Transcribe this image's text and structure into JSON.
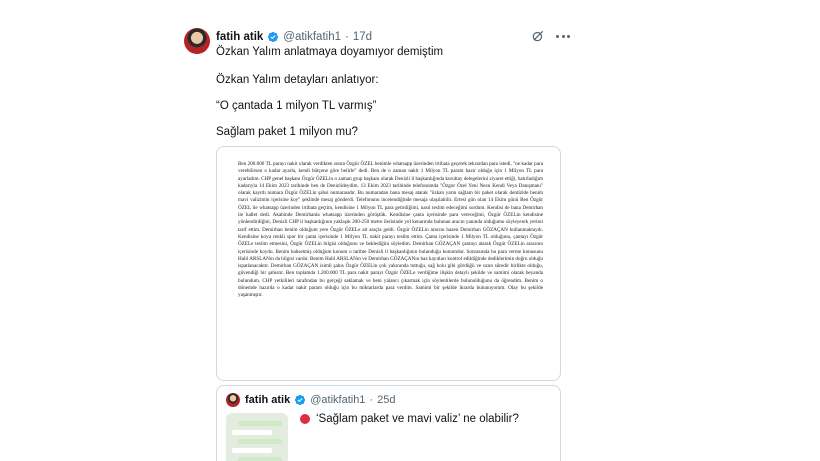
{
  "tweet": {
    "author_name": "fatih atik",
    "handle": "@atikfatih1",
    "separator": "·",
    "age": "17d",
    "lines": [
      "Özkan Yalım anlatmaya doyamıyor demiştim",
      "Özkan Yalım detayları anlatıyor:",
      "“O çantada 1 milyon TL varmış”",
      "Sağlam paket 1 milyon mu?"
    ],
    "document_text": "Ben 200.000 TL parayı nakit olarak verdikten sonra Özgür ÖZEL benimle whatsapp üzerinden irtibata geçerek tekrardan para istedi, \"ne kadar para verebilirsen o kadar ayarla, kendi bütçene göre belirle\" dedi. Ben de o zaman nakit 1 Milyon TL param hazır olduğu için 1 Milyon TL para ayarladım. CHP genel başkanı Özgür ÖZELin o zaman grup başkanı olarak Denizli il başkanlığında kurultay delegelerini ziyaret ettiği, hatırladığım kadarıyla 14 Ekim 2023 tarihinde ben de Denizlideydim. 13 Ekim 2023 tarihinde telefonumda \"Özgur Özel Yeni Nesıı Kendi Veya Danışmanı\" olarak kayıtlı numara Özgür ÖZELin şahsi numarasıdır. Bu numaradan bana mesaj atarak \"özkan yarın sağlam bir paket olarak dentizlde benim mavi valizimin içerisine koy\" şeklinde mesaj gönderdi. Telefonunu incelendiğinde mesaja ulaşılabilir. Ertesi gün olan 14 Ekim günü Ben Özgür ÖZEL ile whatsapp üzerinden irtibata geçtim, kendisine 1 Milyon TL para getirdiğimi, nasıl teslim edeceğimi sordum. Kendisi de bana Demirhan ile hallet dedi. Akabinde Demirhanla whatsapp üzerinden görüştük. Kendisine çanta içerisinde para vereceğimi, Özgür ÖZELin kendisine yönlendirdiğini, Denizli CHP il başkanlığının yaklaşık 200-250 metre ilerisinde yol kenarında bulunan aracın yanında olduğumu söyleyerek yerimi tarif ettim. Demirhan benim olduğum yere Özgür ÖZELe ait araçla geldi. Özgür ÖZELin aracını bazen Demirhan GÖZAÇAN kullanmaktaydı. Kendisine koyu renkli spor bir çanta içerisinde 1 Milyon TL nakit parayı teslim ettim. Çanta içerisinde 1 Milyon TL olduğunu, çantayı Özgür ÖZELe teslim etmesini, Özgür ÖZELin bilgisi olduğunu ve beklediğini söyledim. Demirhan GÖZAÇAN çantayı alarak Özgür ÖZELin aracının içerisinde koydu. Benim bahsetmiş olduğum konum o tarihte Denizli il başkanlığının bulunduğu konumdur. Sonrasında bu para verme konusunu Halil ARSLANın da bilgisi vardır. Benim Halil ARSLANın ve Demirhan GÖZAÇANın baz kayıtları kontrol edildiğinde dediklerimin doğru olduğu ispatlanacaktır. Demirhan GÖZAÇAN isimli şahıs Özgür ÖZELin çok yakınında tuttuğu, sağ kolu gibi gördüğü ve uzun süredir birlikte olduğu, güvendiği bir şahıstır. Ben toplamda 1.200.000 TL para nakit parayı Özgür ÖZELe verdiğime ilişkin detaylı şekilde ve samimi olarak beyanda bulundum. CHP yetkilileri tarafından bu gerçeği saklamak ve beni yalancı çıkarmak için söylentilerde bulunulduğunu da öğrendim. Benim o dönemde hazırda o kadar nakit param olduğu için bu miktarlarda para verdim. Samimi bir şekilde ikrarda bulunuyorum. Olay bu şekilde yaşanmıştır."
  },
  "quoted_tweet": {
    "author_name": "fatih atik",
    "handle": "@atikfatih1",
    "separator": "·",
    "age": "25d",
    "text": "‘Sağlam paket ve mavi valiz’ ne olabilir?"
  },
  "colors": {
    "verified_blue": "#1d9bf0",
    "secondary_text": "#536471",
    "red_circle": "#dd2e44"
  },
  "icons": [
    "verified-badge-icon",
    "grok-icon",
    "more-icon",
    "red-circle-icon"
  ]
}
